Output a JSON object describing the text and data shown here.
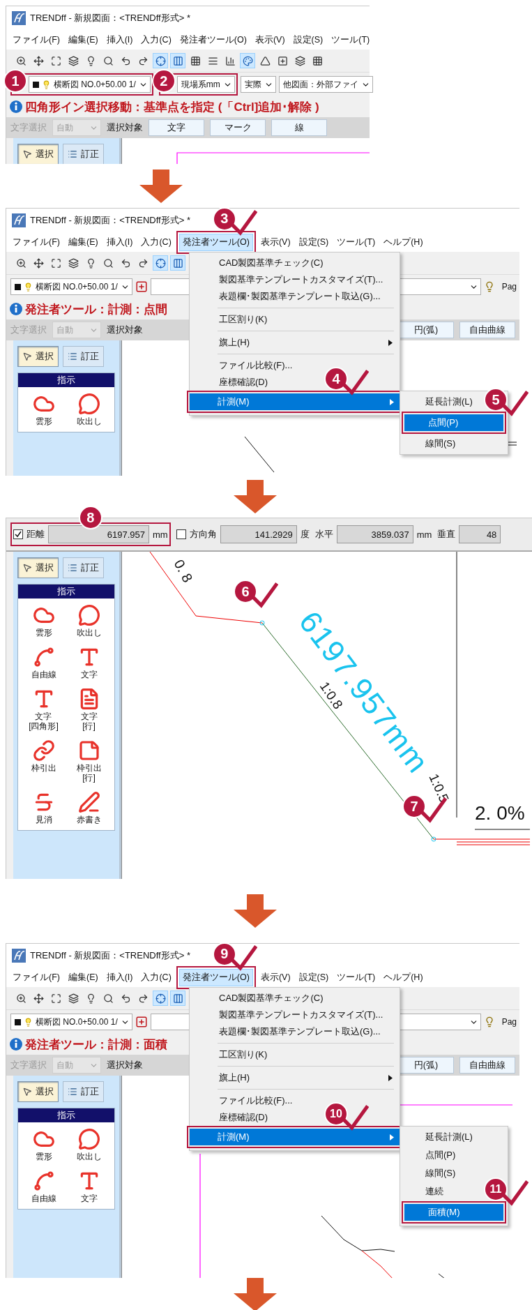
{
  "panels": [
    {
      "kind": "window",
      "title": "TRENDff - 新規図面：<TRENDff形式> *",
      "menu": [
        {
          "label": "ファイル(F)",
          "selected": false
        },
        {
          "label": "編集(E)",
          "selected": false
        },
        {
          "label": "挿入(I)",
          "selected": false
        },
        {
          "label": "入力(C)",
          "selected": false
        },
        {
          "label": "発注者ツール(O)",
          "selected": false
        },
        {
          "label": "表示(V)",
          "selected": false
        },
        {
          "label": "設定(S)",
          "selected": false
        },
        {
          "label": "ツール(T)",
          "selected": false
        }
      ],
      "combos": [
        {
          "kind": "layer",
          "value": "横断図 NO.0+50.00 1/",
          "step": {
            "number": "1",
            "tick": false
          }
        },
        {
          "kind": "plain",
          "value": "現場系mm",
          "step": {
            "number": "2",
            "tick": false
          }
        },
        {
          "kind": "plain",
          "value": "実際"
        },
        {
          "kind": "plain",
          "value": "他図面：外部ファイ"
        }
      ],
      "status": "四角形イン選択移動：基準点を指定 (「Ctrl]追加･解除 )",
      "selector": {
        "filter": {
          "label": "文字選択",
          "disabled": true
        },
        "mode": {
          "value": "自動",
          "disabled": true
        },
        "label": "選択対象",
        "buttons": [
          "文字",
          "マーク",
          "線"
        ]
      },
      "modes": [
        {
          "label": "選択",
          "selected": true
        },
        {
          "label": "訂正",
          "selected": false
        }
      ],
      "canvas": {
        "kind": "frame"
      }
    },
    {
      "kind": "window",
      "title": "TRENDff - 新規図面：<TRENDff形式> *",
      "menu": [
        {
          "label": "ファイル(F)",
          "selected": false
        },
        {
          "label": "編集(E)",
          "selected": false
        },
        {
          "label": "挿入(I)",
          "selected": false
        },
        {
          "label": "入力(C)",
          "selected": false
        },
        {
          "label": "発注者ツール(O)",
          "selected": true,
          "step": {
            "number": "3",
            "tick": true
          }
        },
        {
          "label": "表示(V)",
          "selected": false
        },
        {
          "label": "設定(S)",
          "selected": false
        },
        {
          "label": "ツール(T)",
          "selected": false
        },
        {
          "label": "ヘルプ(H)",
          "selected": false
        }
      ],
      "combos": [
        {
          "kind": "layer",
          "value": "横断図 NO.0+50.00 1/"
        },
        {
          "kind": "blank"
        }
      ],
      "page_label": "Pag",
      "status": "発注者ツール：計測：点間",
      "selector": {
        "filter": {
          "label": "文字選択",
          "disabled": true
        },
        "mode": {
          "value": "自動",
          "disabled": true
        },
        "label": "選択対象",
        "buttons": [
          "円(弧)",
          "自由曲線"
        ]
      },
      "modes": [
        {
          "label": "選択",
          "selected": true
        },
        {
          "label": "訂正",
          "selected": false
        }
      ],
      "palette": {
        "title": "指示",
        "tools": [
          {
            "kind": "cloud",
            "label": "雲形"
          },
          {
            "kind": "balloon",
            "label": "吹出し"
          }
        ]
      },
      "dropdown": {
        "items": [
          {
            "kind": "item",
            "label": "CAD製図基準チェック(C)",
            "selected": false
          },
          {
            "kind": "item",
            "label": "製図基準テンプレートカスタマイズ(T)...",
            "selected": false
          },
          {
            "kind": "item",
            "label": "表題欄･製図基準テンプレート取込(G)...",
            "selected": false
          },
          {
            "kind": "separator"
          },
          {
            "kind": "item",
            "label": "工区割り(K)",
            "selected": false
          },
          {
            "kind": "separator"
          },
          {
            "kind": "submenu",
            "label": "旗上(H)",
            "selected": false
          },
          {
            "kind": "separator"
          },
          {
            "kind": "item",
            "label": "ファイル比較(F)...",
            "selected": false
          },
          {
            "kind": "item",
            "label": "座標確認(D)",
            "selected": false
          },
          {
            "kind": "submenu",
            "label": "計測(M)",
            "selected": true,
            "step": {
              "number": "4",
              "tick": true
            },
            "submenu": [
              {
                "label": "延長計測(L)",
                "selected": false
              },
              {
                "label": "点間(P)",
                "selected": true,
                "step": {
                  "number": "5",
                  "tick": true
                }
              },
              {
                "label": "線間(S)",
                "selected": false
              }
            ]
          }
        ]
      },
      "canvas": {
        "kind": "slope"
      }
    },
    {
      "kind": "measure",
      "fields": [
        {
          "kind": "check",
          "label": "距離",
          "checked": true,
          "value": "6197.957",
          "unit": "mm",
          "step": {
            "number": "8",
            "tick": false
          }
        },
        {
          "kind": "check",
          "label": "方向角",
          "checked": false,
          "value": "141.2929",
          "unit": "度"
        },
        {
          "kind": "plain",
          "label": "水平",
          "value": "3859.037",
          "unit": "mm"
        },
        {
          "kind": "plain",
          "label": "垂直",
          "value": "48"
        }
      ],
      "modes": [
        {
          "label": "選択",
          "selected": true
        },
        {
          "label": "訂正",
          "selected": false
        }
      ],
      "palette": {
        "title": "指示",
        "tools": [
          {
            "kind": "cloud",
            "label": "雲形"
          },
          {
            "kind": "balloon",
            "label": "吹出し"
          },
          {
            "kind": "freeline",
            "label": "自由線"
          },
          {
            "kind": "text",
            "label": "文字"
          },
          {
            "kind": "text",
            "label": "文字\n[四角形]"
          },
          {
            "kind": "document",
            "label": "文字\n[行]"
          },
          {
            "kind": "leader",
            "label": "枠引出"
          },
          {
            "kind": "note",
            "label": "枠引出\n[行]"
          },
          {
            "kind": "strike",
            "label": "見消"
          },
          {
            "kind": "pen",
            "label": "赤書き"
          }
        ]
      },
      "canvas": {
        "kind": "measure",
        "labels": [
          {
            "kind": "note",
            "text": "0. 8"
          },
          {
            "kind": "result",
            "text": "6197.957mm"
          },
          {
            "kind": "note",
            "text": "1:0.8"
          },
          {
            "kind": "note",
            "text": "1:0.5"
          },
          {
            "kind": "grade",
            "text": "2. 0%"
          }
        ],
        "markers": [
          {
            "number": "6",
            "tick": true
          },
          {
            "number": "7",
            "tick": true
          }
        ]
      }
    },
    {
      "kind": "window",
      "title": "TRENDff - 新規図面：<TRENDff形式> *",
      "menu": [
        {
          "label": "ファイル(F)",
          "selected": false
        },
        {
          "label": "編集(E)",
          "selected": false
        },
        {
          "label": "挿入(I)",
          "selected": false
        },
        {
          "label": "入力(C)",
          "selected": false
        },
        {
          "label": "発注者ツール(O)",
          "selected": true,
          "step": {
            "number": "9",
            "tick": true
          }
        },
        {
          "label": "表示(V)",
          "selected": false
        },
        {
          "label": "設定(S)",
          "selected": false
        },
        {
          "label": "ツール(T)",
          "selected": false
        },
        {
          "label": "ヘルプ(H)",
          "selected": false
        }
      ],
      "combos": [
        {
          "kind": "layer",
          "value": "横断図 NO.0+50.00 1/"
        },
        {
          "kind": "blank"
        }
      ],
      "page_label": "Pag",
      "status": "発注者ツール：計測：面積",
      "selector": {
        "filter": {
          "label": "文字選択",
          "disabled": true
        },
        "mode": {
          "value": "自動",
          "disabled": true
        },
        "label": "選択対象",
        "buttons": [
          "円(弧)",
          "自由曲線"
        ]
      },
      "modes": [
        {
          "label": "選択",
          "selected": true
        },
        {
          "label": "訂正",
          "selected": false
        }
      ],
      "palette": {
        "title": "指示",
        "tools": [
          {
            "kind": "cloud",
            "label": "雲形"
          },
          {
            "kind": "balloon",
            "label": "吹出し"
          },
          {
            "kind": "freeline",
            "label": "自由線"
          },
          {
            "kind": "text",
            "label": "文字"
          }
        ]
      },
      "dropdown": {
        "items": [
          {
            "kind": "item",
            "label": "CAD製図基準チェック(C)",
            "selected": false
          },
          {
            "kind": "item",
            "label": "製図基準テンプレートカスタマイズ(T)...",
            "selected": false
          },
          {
            "kind": "item",
            "label": "表題欄･製図基準テンプレート取込(G)...",
            "selected": false
          },
          {
            "kind": "separator"
          },
          {
            "kind": "item",
            "label": "工区割り(K)",
            "selected": false
          },
          {
            "kind": "separator"
          },
          {
            "kind": "submenu",
            "label": "旗上(H)",
            "selected": false
          },
          {
            "kind": "separator"
          },
          {
            "kind": "item",
            "label": "ファイル比較(F)...",
            "selected": false
          },
          {
            "kind": "item",
            "label": "座標確認(D)",
            "selected": false
          },
          {
            "kind": "submenu",
            "label": "計測(M)",
            "selected": true,
            "step": {
              "number": "10",
              "tick": true
            },
            "submenu": [
              {
                "label": "延長計測(L)",
                "selected": false
              },
              {
                "label": "点間(P)",
                "selected": false
              },
              {
                "label": "線間(S)",
                "selected": false
              },
              {
                "label": "連続",
                "selected": false
              },
              {
                "label": "面積(M)",
                "selected": true,
                "step": {
                  "number": "11",
                  "tick": true
                }
              }
            ]
          }
        ]
      },
      "canvas": {
        "kind": "area"
      }
    }
  ]
}
